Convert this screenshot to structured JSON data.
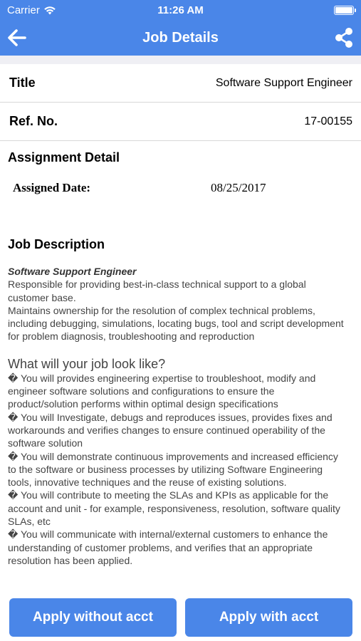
{
  "status_bar": {
    "carrier": "Carrier",
    "time": "11:26 AM"
  },
  "nav": {
    "title": "Job Details"
  },
  "details": {
    "title_label": "Title",
    "title_value": "Software Support Engineer",
    "ref_label": "Ref. No.",
    "ref_value": "17-00155"
  },
  "assignment": {
    "heading": "Assignment Detail",
    "assigned_date_label": "Assigned Date:",
    "assigned_date_value": "08/25/2017"
  },
  "description": {
    "heading": "Job Description",
    "role": "Software Support Engineer",
    "intro_lines": [
      "Responsible for providing best-in-class technical support to a global customer base.",
      "Maintains ownership for the resolution of complex technical problems, including debugging, simulations, locating bugs, tool and script development for problem diagnosis, troubleshooting and reproduction"
    ],
    "look_heading": "What will your job look like?",
    "bullet_glyph": "�",
    "bullets": [
      " You will provides engineering expertise to troubleshoot, modify and engineer software solutions and configurations to ensure the product/solution performs within optimal design specifications",
      " You will Investigate, debugs and reproduces issues, provides fixes and workarounds and verifies changes to ensure continued operability of the software solution",
      " You will demonstrate continuous improvements and increased efficiency to the software or business processes by utilizing Software Engineering tools, innovative techniques and the reuse of existing solutions.",
      " You will contribute to meeting the SLAs and KPIs as applicable for the account and unit - for example, responsiveness, resolution, software quality SLAs, etc",
      " You will communicate with internal/external customers to enhance the understanding of customer problems, and verifies that an appropriate resolution has been applied."
    ]
  },
  "actions": {
    "apply_without_label": "Apply without acct",
    "apply_with_label": "Apply with acct"
  },
  "colors": {
    "accent": "#4a86e8"
  },
  "icons": {
    "back": "back-arrow-icon",
    "share": "share-icon",
    "wifi": "wifi-icon",
    "battery": "battery-icon"
  }
}
